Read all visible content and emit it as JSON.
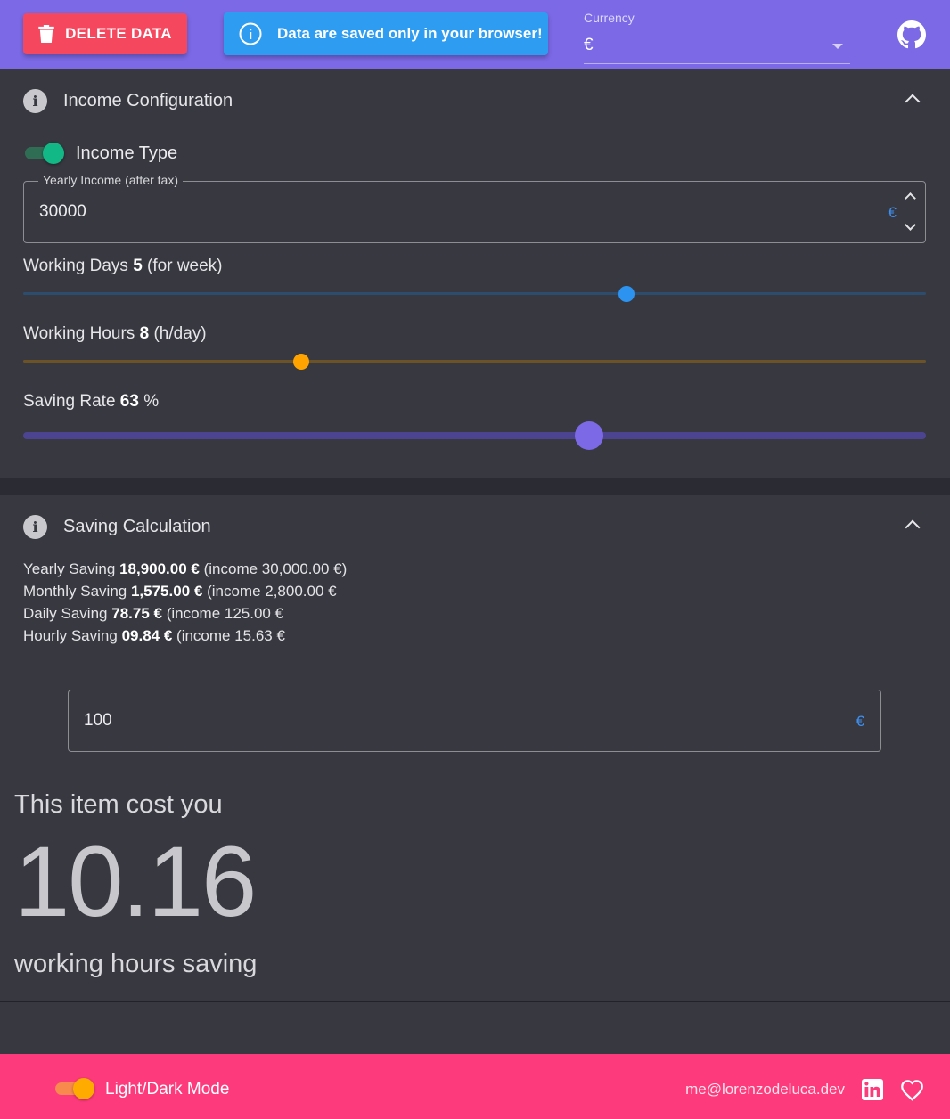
{
  "header": {
    "delete_label": "DELETE DATA",
    "banner_text": "Data are saved only in your browser!",
    "currency": {
      "label": "Currency",
      "value": "€"
    }
  },
  "income": {
    "title": "Income Configuration",
    "toggle_label": "Income Type",
    "toggle_on": true,
    "yearly_field": {
      "label": "Yearly Income (after tax)",
      "value": "30000",
      "suffix": "€"
    },
    "sliders": [
      {
        "label": "Working Days",
        "value": "5",
        "unit": "(for week)",
        "min": 0,
        "max": 7,
        "level": 0.668,
        "color": "#2d93f0"
      },
      {
        "label": "Working Hours",
        "value": "8",
        "unit": "(h/day)",
        "min": 0,
        "max": 24,
        "level": 0.308,
        "color": "#ffa300"
      },
      {
        "label": "Saving Rate",
        "value": "63",
        "unit": "%",
        "min": 0,
        "max": 100,
        "level": 0.627,
        "color": "#7b69e5"
      }
    ]
  },
  "saving": {
    "title": "Saving Calculation",
    "rows": [
      {
        "label": "Yearly Saving",
        "amount": "18,900.00 €",
        "income": "(income 30,000.00 €)"
      },
      {
        "label": "Monthly Saving",
        "amount": "1,575.00 €",
        "income": "(income 2,800.00 €"
      },
      {
        "label": "Daily Saving",
        "amount": "78.75 €",
        "income": "(income 125.00 €"
      },
      {
        "label": "Hourly Saving",
        "amount": "09.84 €",
        "income": "(income 15.63 €"
      }
    ],
    "item_field": {
      "value": "100",
      "suffix": "€"
    },
    "cost_label": "This item cost you",
    "cost_value": "10.16",
    "cost_unit": "working hours saving"
  },
  "footer": {
    "mode_label": "Light/Dark Mode",
    "email": "me@lorenzodeluca.dev"
  },
  "icons": {
    "delete": "trash-icon",
    "banner": "info-circle-icon",
    "github": "github-icon",
    "linkedin": "linkedin-icon",
    "heart": "heart-icon"
  },
  "colors": {
    "header_bg": "#7b69e5",
    "delete_button": "#f5475e",
    "banner": "#2d9cf1",
    "panel_bg": "#373840",
    "footer_bg": "#fd3b7c",
    "toggle_on": "#12b886"
  }
}
